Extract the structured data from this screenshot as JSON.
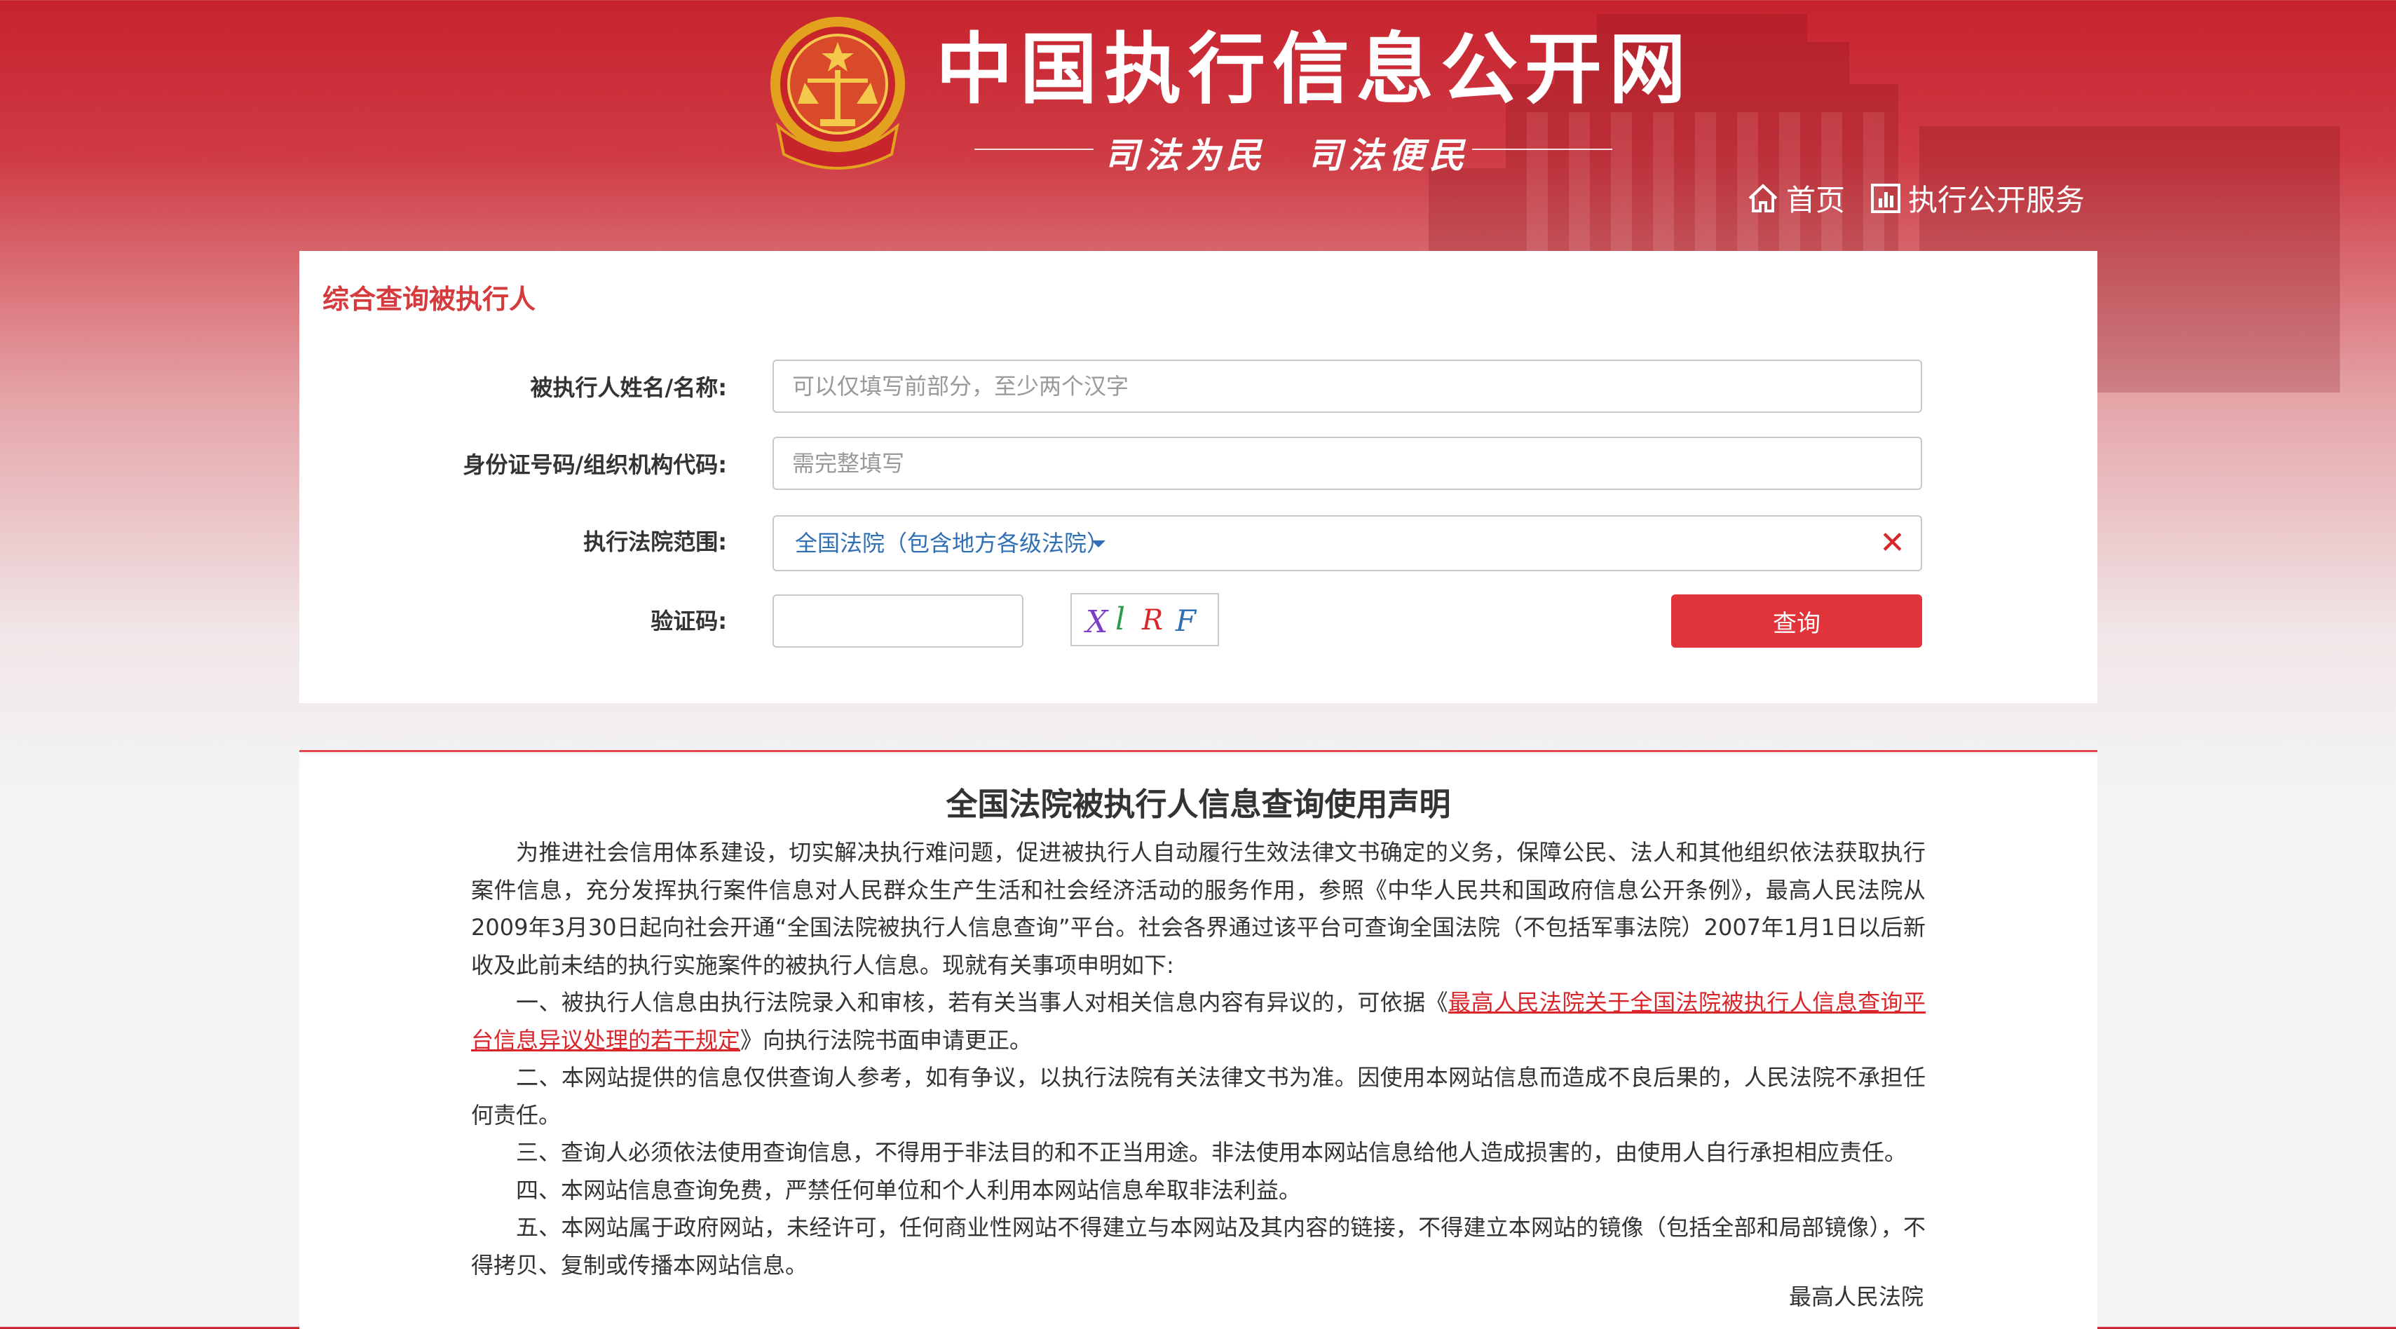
{
  "header": {
    "title": "中国执行信息公开网",
    "slogan": "司法为民　司法便民",
    "nav": [
      {
        "label": "首页",
        "icon": "home-icon"
      },
      {
        "label": "执行公开服务",
        "icon": "chart-icon"
      }
    ]
  },
  "search": {
    "title": "综合查询被执行人",
    "name_label": "被执行人姓名/名称:",
    "name_placeholder": "可以仅填写前部分，至少两个汉字",
    "id_label": "身份证号码/组织机构代码:",
    "id_placeholder": "需完整填写",
    "court_label": "执行法院范围:",
    "court_value": "全国法院（包含地方各级法院）",
    "captcha_label": "验证码:",
    "captcha_text": "XlRF",
    "query_button": "查询"
  },
  "notice": {
    "title": "全国法院被执行人信息查询使用声明",
    "intro": "为推进社会信用体系建设，切实解决执行难问题，促进被执行人自动履行生效法律文书确定的义务，保障公民、法人和其他组织依法获取执行案件信息，充分发挥执行案件信息对人民群众生产生活和社会经济活动的服务作用，参照《中华人民共和国政府信息公开条例》，最高人民法院从2009年3月30日起向社会开通“全国法院被执行人信息查询”平台。社会各界通过该平台可查询全国法院（不包括军事法院）2007年1月1日以后新收及此前未结的执行实施案件的被执行人信息。现就有关事项申明如下:",
    "item1_prefix": "一、被执行人信息由执行法院录入和审核，若有关当事人对相关信息内容有异议的，可依据《",
    "item1_link": "最高人民法院关于全国法院被执行人信息查询平台信息异议处理的若干规定",
    "item1_suffix": "》向执行法院书面申请更正。",
    "item2": "二、本网站提供的信息仅供查询人参考，如有争议，以执行法院有关法律文书为准。因使用本网站信息而造成不良后果的，人民法院不承担任何责任。",
    "item3": "三、查询人必须依法使用查询信息，不得用于非法目的和不正当用途。非法使用本网站信息给他人造成损害的，由使用人自行承担相应责任。",
    "item4": "四、本网站信息查询免费，严禁任何单位和个人利用本网站信息牟取非法利益。",
    "item5": "五、本网站属于政府网站，未经许可，任何商业性网站不得建立与本网站及其内容的链接，不得建立本网站的镜像（包括全部和局部镜像），不得拷贝、复制或传播本网站信息。",
    "signature": "最高人民法院"
  },
  "colors": {
    "header_red": "#c7232e",
    "accent_red": "#e0333a",
    "link_red": "#d9262b",
    "select_blue": "#2f6fb4"
  }
}
